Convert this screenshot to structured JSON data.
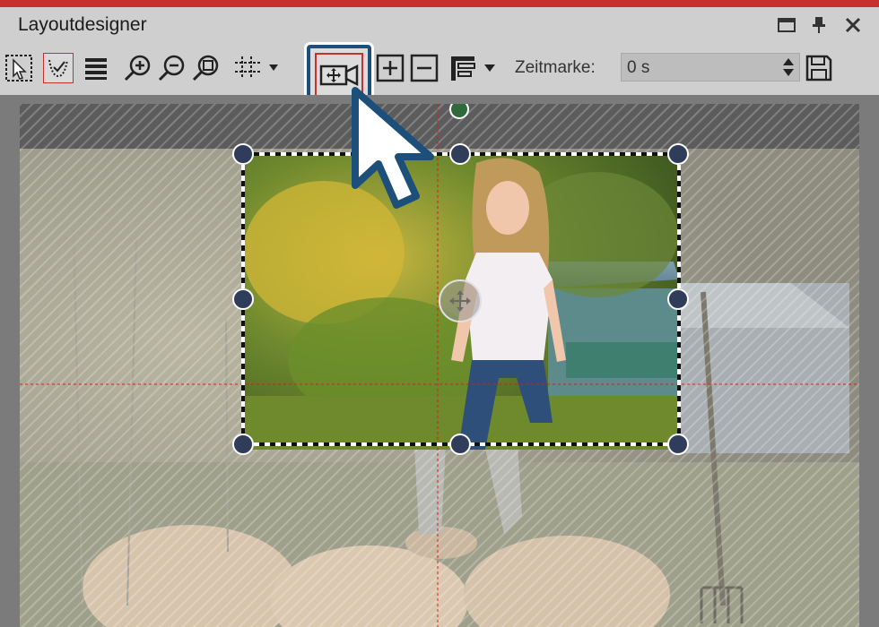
{
  "window": {
    "title": "Layoutdesigner",
    "buttons": [
      "maximize-icon",
      "pin-icon",
      "close-icon"
    ]
  },
  "toolbar": {
    "zeitmarke_label": "Zeitmarke:",
    "zeitmarke_value": "0 s",
    "icons": [
      "selection-tool-icon",
      "curve-tool-icon",
      "list-view-icon",
      "zoom-in-icon",
      "zoom-out-icon",
      "zoom-fit-icon",
      "grid-icon",
      "camera-pan-icon",
      "add-keyframe-icon",
      "remove-keyframe-icon",
      "align-icon",
      "save-icon"
    ]
  },
  "colors": {
    "accent_red": "#c8302e",
    "toolbar_bg": "#cfcfcf",
    "handle_fill": "#2f3d5a",
    "rotate_handle": "#2e6a3c",
    "highlight_border": "#1c4f79",
    "guide_line": "#d02020"
  }
}
